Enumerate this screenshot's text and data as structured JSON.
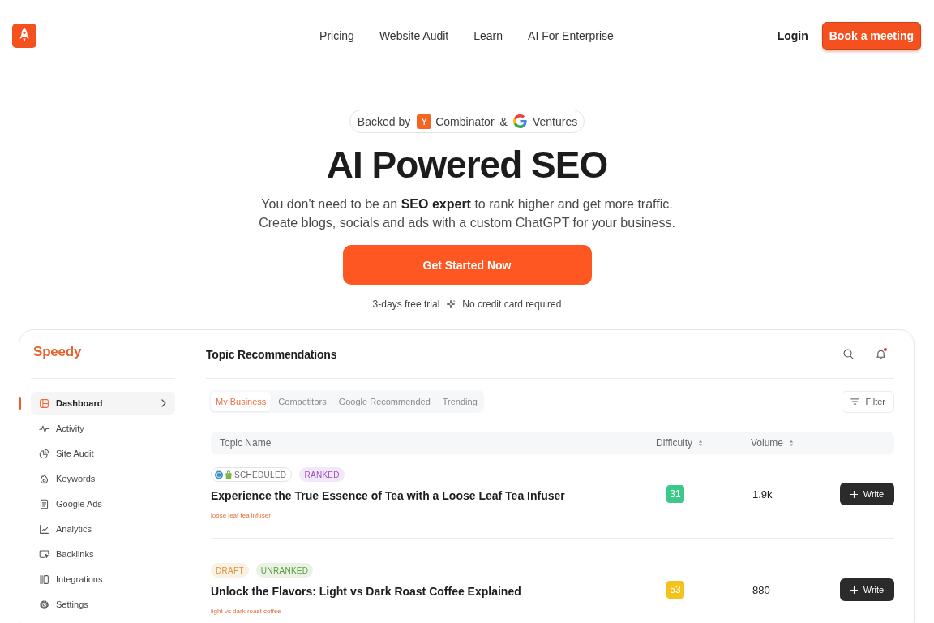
{
  "header": {
    "nav": [
      "Pricing",
      "Website Audit",
      "Learn",
      "AI For Enterprise"
    ],
    "login": "Login",
    "cta": "Book a meeting"
  },
  "hero": {
    "backed": {
      "prefix": "Backed by",
      "yc_mark": "Y",
      "yc": "Combinator",
      "amp": "&",
      "google": "Ventures"
    },
    "title": "AI Powered SEO",
    "subtitle": [
      "You don't need to be an **SEO expert** to rank higher and get more traffic.",
      "Create blogs, socials and ads with a custom ChatGPT for your business."
    ],
    "cta": "Get Started Now",
    "notes": [
      "3-days free trial",
      "No credit card required"
    ]
  },
  "dashboard": {
    "brand": "Speedy",
    "sidebar": {
      "items": [
        {
          "label": "Dashboard",
          "selected": true
        },
        {
          "label": "Activity",
          "selected": false
        },
        {
          "label": "Site Audit",
          "selected": false
        },
        {
          "label": "Keywords",
          "selected": false
        },
        {
          "label": "Google Ads",
          "selected": false
        },
        {
          "label": "Analytics",
          "selected": false
        },
        {
          "label": "Backlinks",
          "selected": false
        },
        {
          "label": "Integrations",
          "selected": false
        },
        {
          "label": "Settings",
          "selected": false
        }
      ]
    },
    "title": "Topic Recommendations",
    "notification": true,
    "tabs": [
      {
        "label": "My Business",
        "selected": true
      },
      {
        "label": "Competitors",
        "selected": false
      },
      {
        "label": "Google Recommended",
        "selected": false
      },
      {
        "label": "Trending",
        "selected": false
      }
    ],
    "filter": "Filter",
    "table": {
      "columns": [
        {
          "label": "Topic Name",
          "sortable": false
        },
        {
          "label": "Difficulty",
          "sortable": true
        },
        {
          "label": "Volume",
          "sortable": true
        }
      ],
      "rows": [
        {
          "tags": [
            {
              "label": "SCHEDULED",
              "kind": "outline",
              "color": "#6b6b6b"
            },
            {
              "label": "RANKED",
              "kind": "fill",
              "color": "#9b51c9"
            }
          ],
          "title": "Experience the True Essence of Tea with a Loose Leaf Tea Infuser",
          "keyword": "loose leaf tea infuser",
          "difficulty": {
            "value": "31",
            "color": "#3cc98a"
          },
          "volume": "1.9k",
          "action": "Write"
        },
        {
          "tags": [
            {
              "label": "DRAFT",
              "kind": "fill",
              "color": "#d9963a"
            },
            {
              "label": "UNRANKED",
              "kind": "fill",
              "color": "#5c9e3c"
            }
          ],
          "title": "Unlock the Flavors: Light vs Dark Roast Coffee Explained",
          "keyword": "light vs dark roast coffee",
          "difficulty": {
            "value": "53",
            "color": "#f4c21b"
          },
          "volume": "880",
          "action": "Write"
        }
      ]
    }
  }
}
